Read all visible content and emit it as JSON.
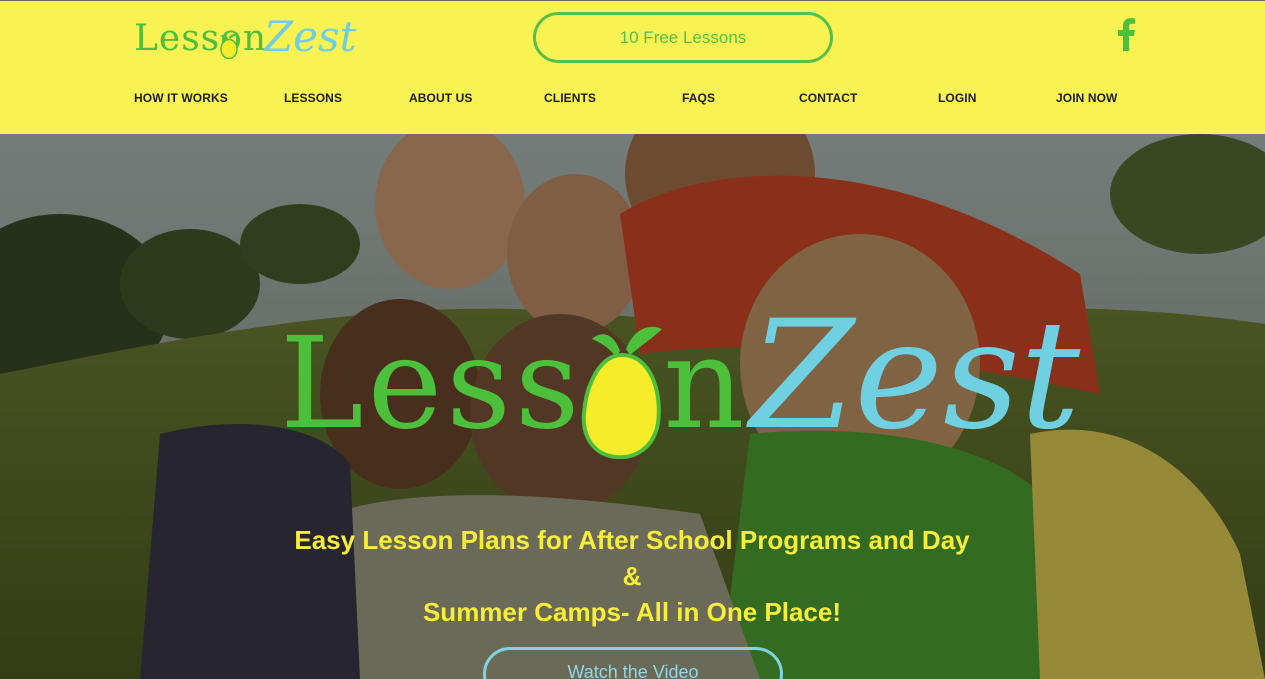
{
  "brand": {
    "word_1": "Lesson",
    "word_2": "Zest",
    "green": "#4cbf3b",
    "blue": "#6fd0e2",
    "yellow": "#f8f253"
  },
  "header": {
    "cta_label": "10 Free Lessons",
    "social_icon": "facebook-icon"
  },
  "nav": {
    "items": [
      {
        "label": "HOW IT WORKS"
      },
      {
        "label": "LESSONS"
      },
      {
        "label": "ABOUT US"
      },
      {
        "label": "CLIENTS"
      },
      {
        "label": "FAQS"
      },
      {
        "label": "CONTACT"
      },
      {
        "label": "LOGIN"
      },
      {
        "label": "JOIN NOW"
      }
    ]
  },
  "hero": {
    "tagline_line_1": "Easy Lesson Plans for After School Programs and Day &",
    "tagline_line_2": "Summer Camps- All in One Place!",
    "video_button_label": "Watch the Video"
  }
}
